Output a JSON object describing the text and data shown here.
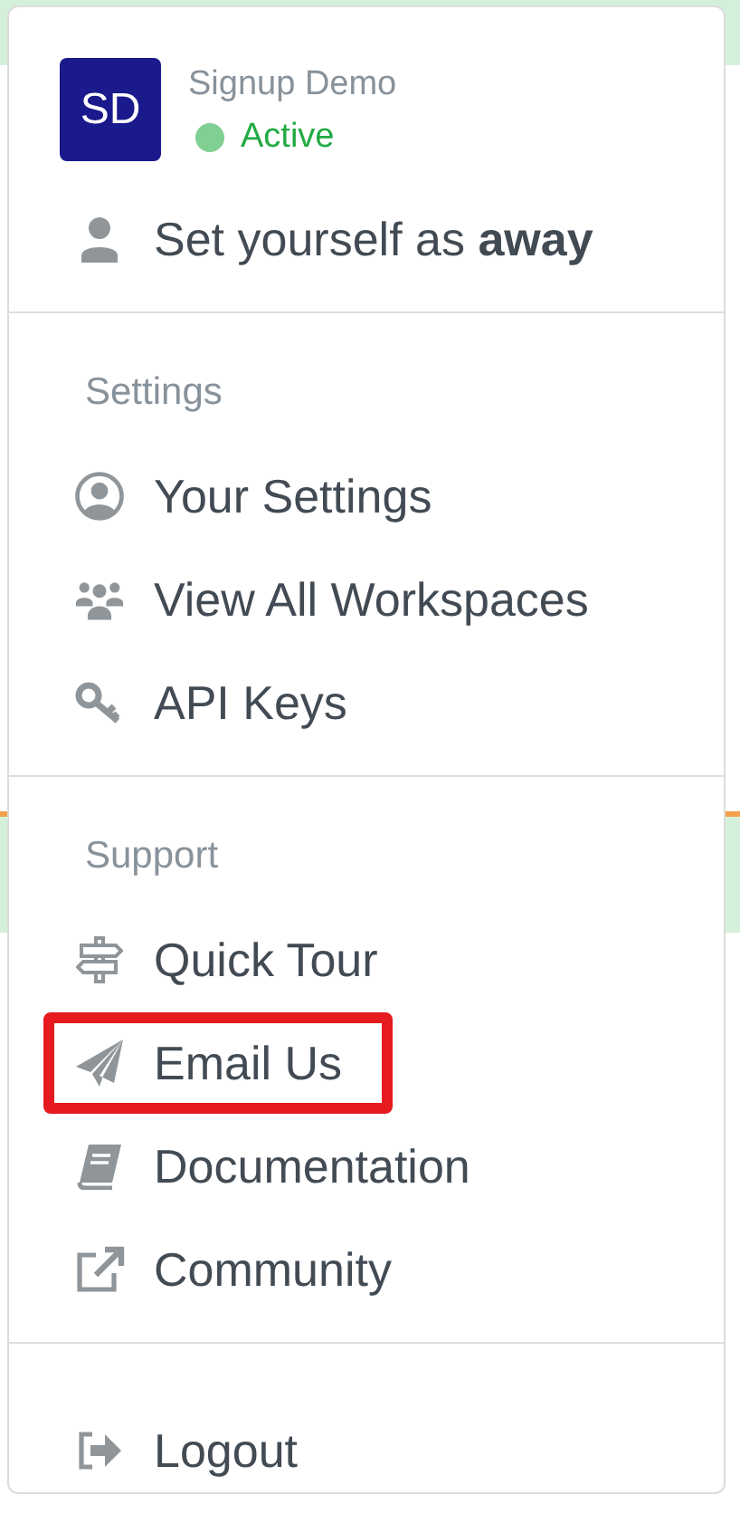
{
  "user": {
    "initials": "SD",
    "name": "Signup Demo",
    "status": {
      "label": "Active",
      "active": true
    }
  },
  "away_action": "Set yourself as **away**",
  "sections": [
    {
      "label": "Settings",
      "items": [
        {
          "label": "Your Settings",
          "highlighted": false
        },
        {
          "label": "View All Workspaces",
          "highlighted": false
        },
        {
          "label": "API Keys",
          "highlighted": false
        }
      ]
    },
    {
      "label": "Support",
      "items": [
        {
          "label": "Quick Tour",
          "highlighted": false
        },
        {
          "label": "Email Us",
          "highlighted": true
        },
        {
          "label": "Documentation",
          "highlighted": false
        },
        {
          "label": "Community",
          "highlighted": false
        }
      ]
    },
    {
      "items": [
        {
          "label": "Logout",
          "highlighted": false
        }
      ]
    }
  ]
}
